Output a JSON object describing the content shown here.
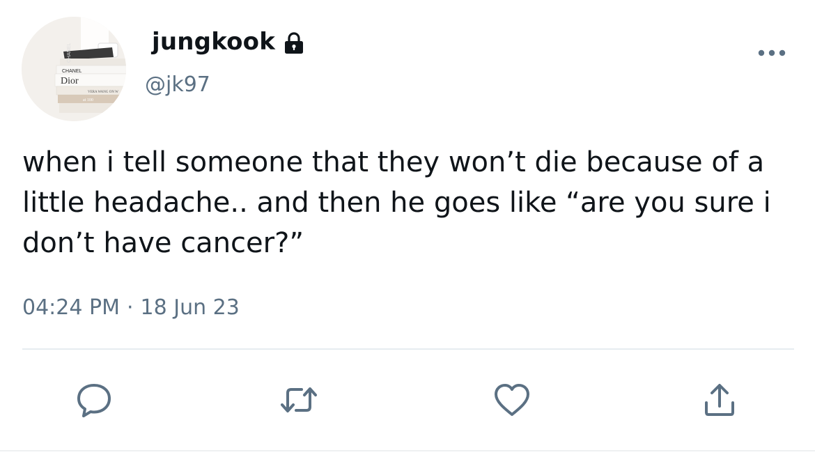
{
  "profile": {
    "avatar_texts": {
      "spine_top": "CHANEL",
      "book_label": "CHANEL",
      "book_title": "Dior",
      "book_spine_small": "VERA WANG ON W",
      "book_bottom": "at 100"
    },
    "display_name": "jungkook",
    "handle": "@jk97",
    "protected_icon": "lock-icon"
  },
  "tweet": {
    "text": "when i tell someone that they won’t die because of a little headache.. and then he goes like “are you sure i don’t have cancer?”",
    "time": "04:24 PM",
    "separator": "·",
    "date": "18 Jun 23"
  },
  "actions": [
    {
      "name": "reply",
      "icon": "speech-bubble-icon"
    },
    {
      "name": "retweet",
      "icon": "retweet-arrows-icon"
    },
    {
      "name": "like",
      "icon": "heart-icon"
    },
    {
      "name": "share",
      "icon": "share-upload-icon"
    }
  ],
  "colors": {
    "text_primary": "#0f1419",
    "text_secondary": "#5b7083",
    "icon": "#5b7083",
    "divider": "#e6ecf0"
  }
}
